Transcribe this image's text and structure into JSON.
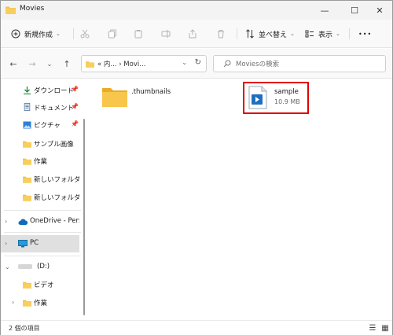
{
  "window": {
    "title": "Movies",
    "min_glyph": "—",
    "max_glyph": "☐",
    "close_glyph": "✕"
  },
  "commandbar": {
    "new_label": "新規作成",
    "sort_label": "並べ替え",
    "view_label": "表示",
    "more_glyph": "•••"
  },
  "address": {
    "path": "« 内... › Movi...",
    "search_placeholder": "Moviesの検索"
  },
  "sidebar": {
    "items": [
      {
        "label": "ダウンロード",
        "icon": "download-icon",
        "pinned": true
      },
      {
        "label": "ドキュメント",
        "icon": "document-icon",
        "pinned": true
      },
      {
        "label": "ピクチャ",
        "icon": "pictures-icon",
        "pinned": true
      },
      {
        "label": "サンプル画像",
        "icon": "folder-icon"
      },
      {
        "label": "作業",
        "icon": "folder-icon"
      },
      {
        "label": "新しいフォルダー",
        "icon": "folder-icon"
      },
      {
        "label": "新しいフォルダー (",
        "icon": "folder-icon"
      },
      {
        "label": "OneDrive - Perso",
        "icon": "cloud-icon"
      },
      {
        "label": "PC",
        "icon": "pc-icon",
        "selected": true
      },
      {
        "label": "(D:)",
        "icon": "drive-icon"
      },
      {
        "label": "ビデオ",
        "icon": "folder-icon"
      },
      {
        "label": "作業",
        "icon": "folder-icon"
      }
    ]
  },
  "files": [
    {
      "name": ".thumbnails",
      "type": "folder",
      "size": ""
    },
    {
      "name": "sample",
      "type": "video",
      "size": "10.9 MB"
    }
  ],
  "status": {
    "count": "2 個の項目"
  },
  "colors": {
    "highlight": "#e00000",
    "folder": "#f5c242",
    "accent": "#0067c0"
  }
}
